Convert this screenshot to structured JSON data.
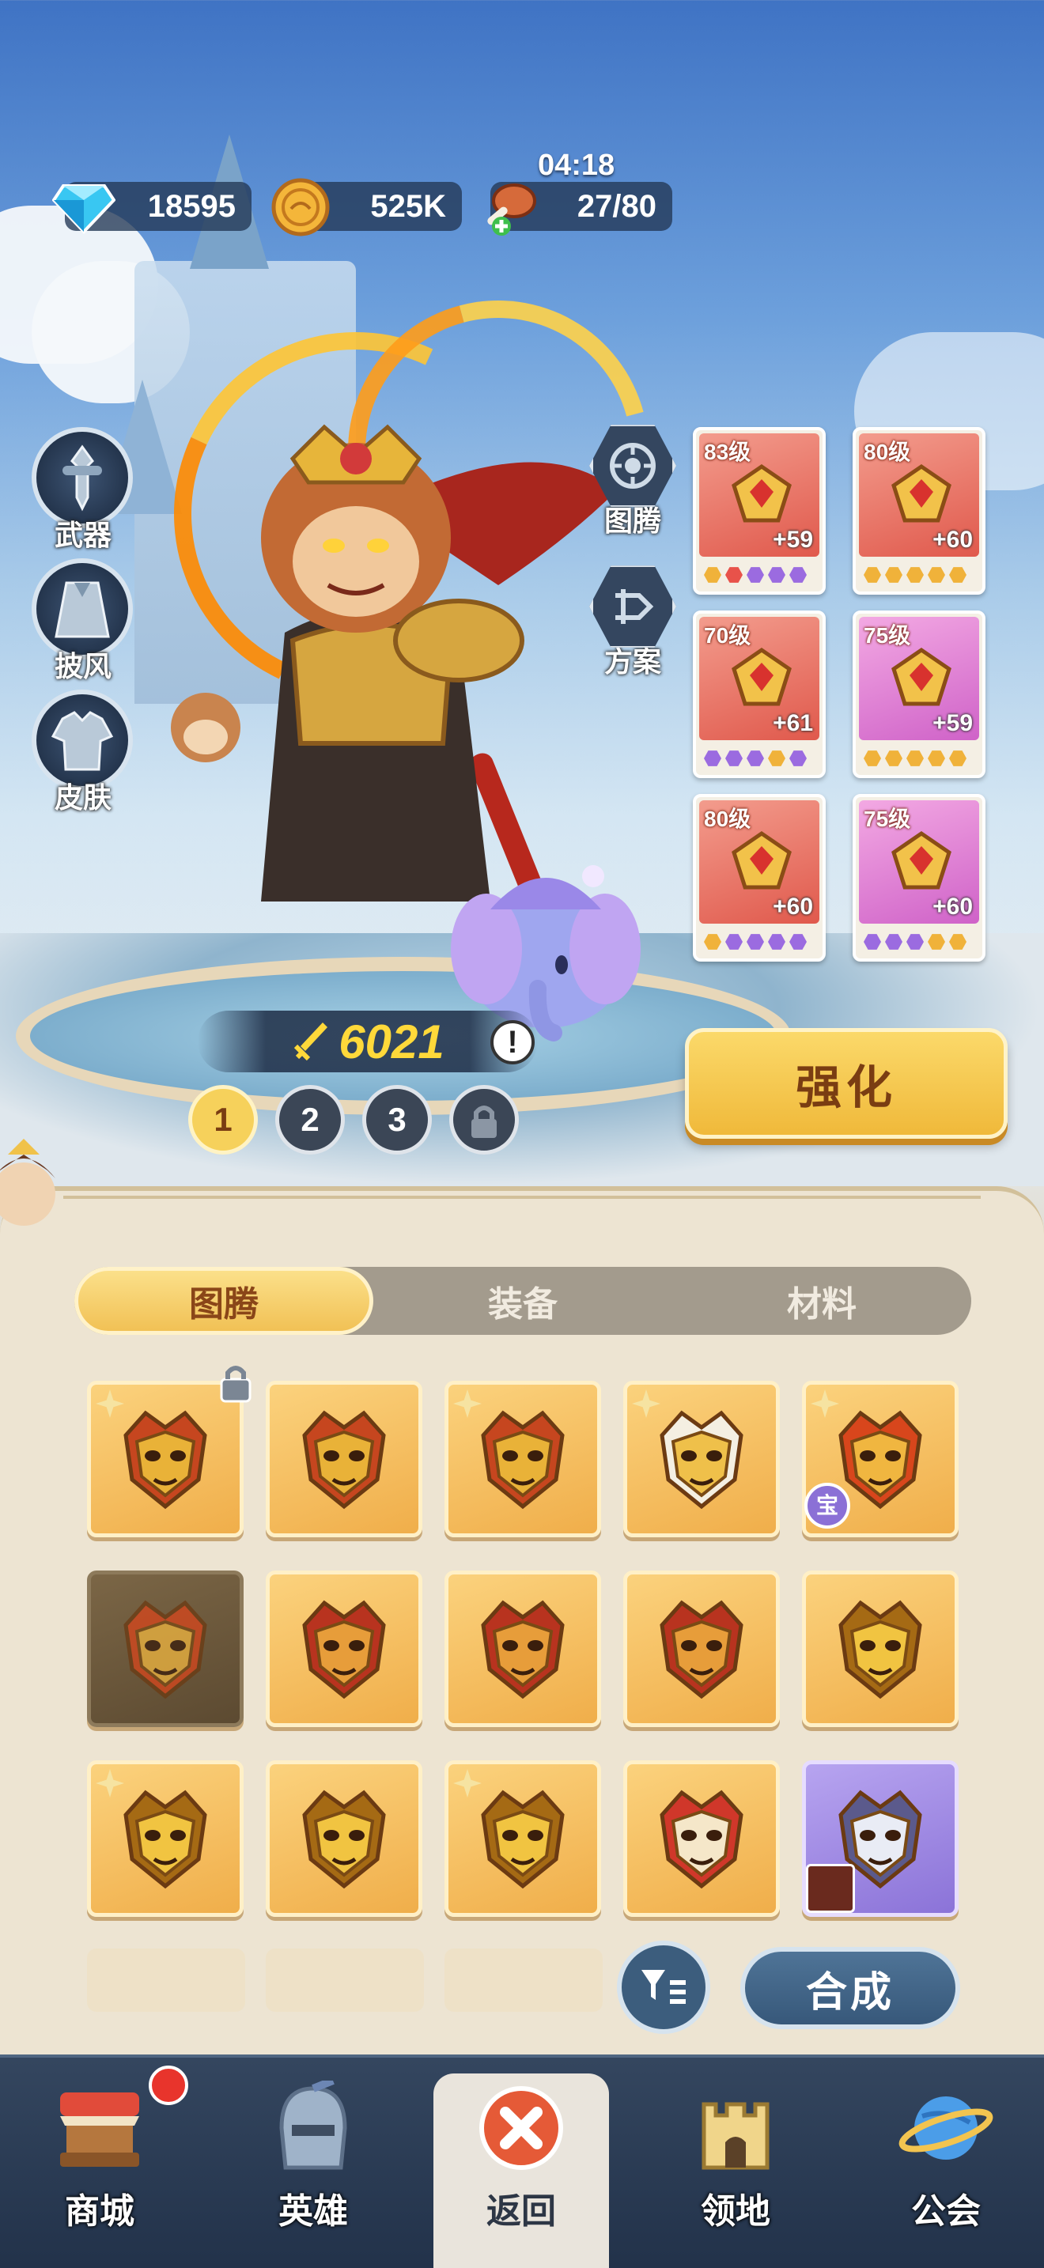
{
  "resources": {
    "gems": "18595",
    "gold": "525K",
    "stamina": "27/80",
    "timer": "04:18"
  },
  "side_menu": [
    "武器",
    "披风",
    "皮肤"
  ],
  "mid_menu": [
    "图腾",
    "方案"
  ],
  "equipment": [
    {
      "level": "83级",
      "plus": "+59",
      "rarity": "red",
      "dots": [
        "#f0b23a",
        "#e8524a",
        "#9b6be0",
        "#9b6be0",
        "#9b6be0"
      ]
    },
    {
      "level": "80级",
      "plus": "+60",
      "rarity": "red",
      "dots": [
        "#f0b23a",
        "#f0b23a",
        "#f0b23a",
        "#f0b23a",
        "#f0b23a"
      ]
    },
    {
      "level": "70级",
      "plus": "+61",
      "rarity": "red",
      "dots": [
        "#9b6be0",
        "#9b6be0",
        "#9b6be0",
        "#f0b23a",
        "#9b6be0"
      ]
    },
    {
      "level": "75级",
      "plus": "+59",
      "rarity": "pink",
      "dots": [
        "#f0b23a",
        "#f0b23a",
        "#f0b23a",
        "#f0b23a",
        "#f0b23a"
      ]
    },
    {
      "level": "80级",
      "plus": "+60",
      "rarity": "red",
      "dots": [
        "#f0b23a",
        "#9b6be0",
        "#9b6be0",
        "#9b6be0",
        "#9b6be0"
      ]
    },
    {
      "level": "75级",
      "plus": "+60",
      "rarity": "pink",
      "dots": [
        "#9b6be0",
        "#9b6be0",
        "#9b6be0",
        "#f0b23a",
        "#f0b23a"
      ]
    }
  ],
  "power": "6021",
  "power_alert": "!",
  "strengthen_label": "强化",
  "presets": [
    "1",
    "2",
    "3"
  ],
  "tabs": [
    "图腾",
    "装备",
    "材料"
  ],
  "active_tab": "图腾",
  "treasure_badge": "宝",
  "merge_label": "合成",
  "nav": [
    "商城",
    "英雄",
    "返回",
    "领地",
    "公会"
  ],
  "colors": {
    "accent_gold": "#f1c155",
    "panel": "#ede4d2",
    "nav_bg": "#2b3c55",
    "alert_red": "#e8342c"
  },
  "icons": {
    "gems": "diamond-icon",
    "gold": "coin-icon",
    "stamina": "meat-icon",
    "totem_cells": [
      "lion-mask-icon",
      "lion-mask-icon",
      "lion-mask-icon",
      "bull-mask-icon",
      "phoenix-mask-icon",
      "phoenix-mask-icon",
      "owl-mask-icon",
      "owl-mask-icon",
      "owl-mask-icon",
      "horned-mask-icon",
      "horned-mask-icon",
      "horned-mask-icon",
      "horned-mask-icon",
      "cat-mask-icon",
      "tiger-mask-icon"
    ]
  }
}
